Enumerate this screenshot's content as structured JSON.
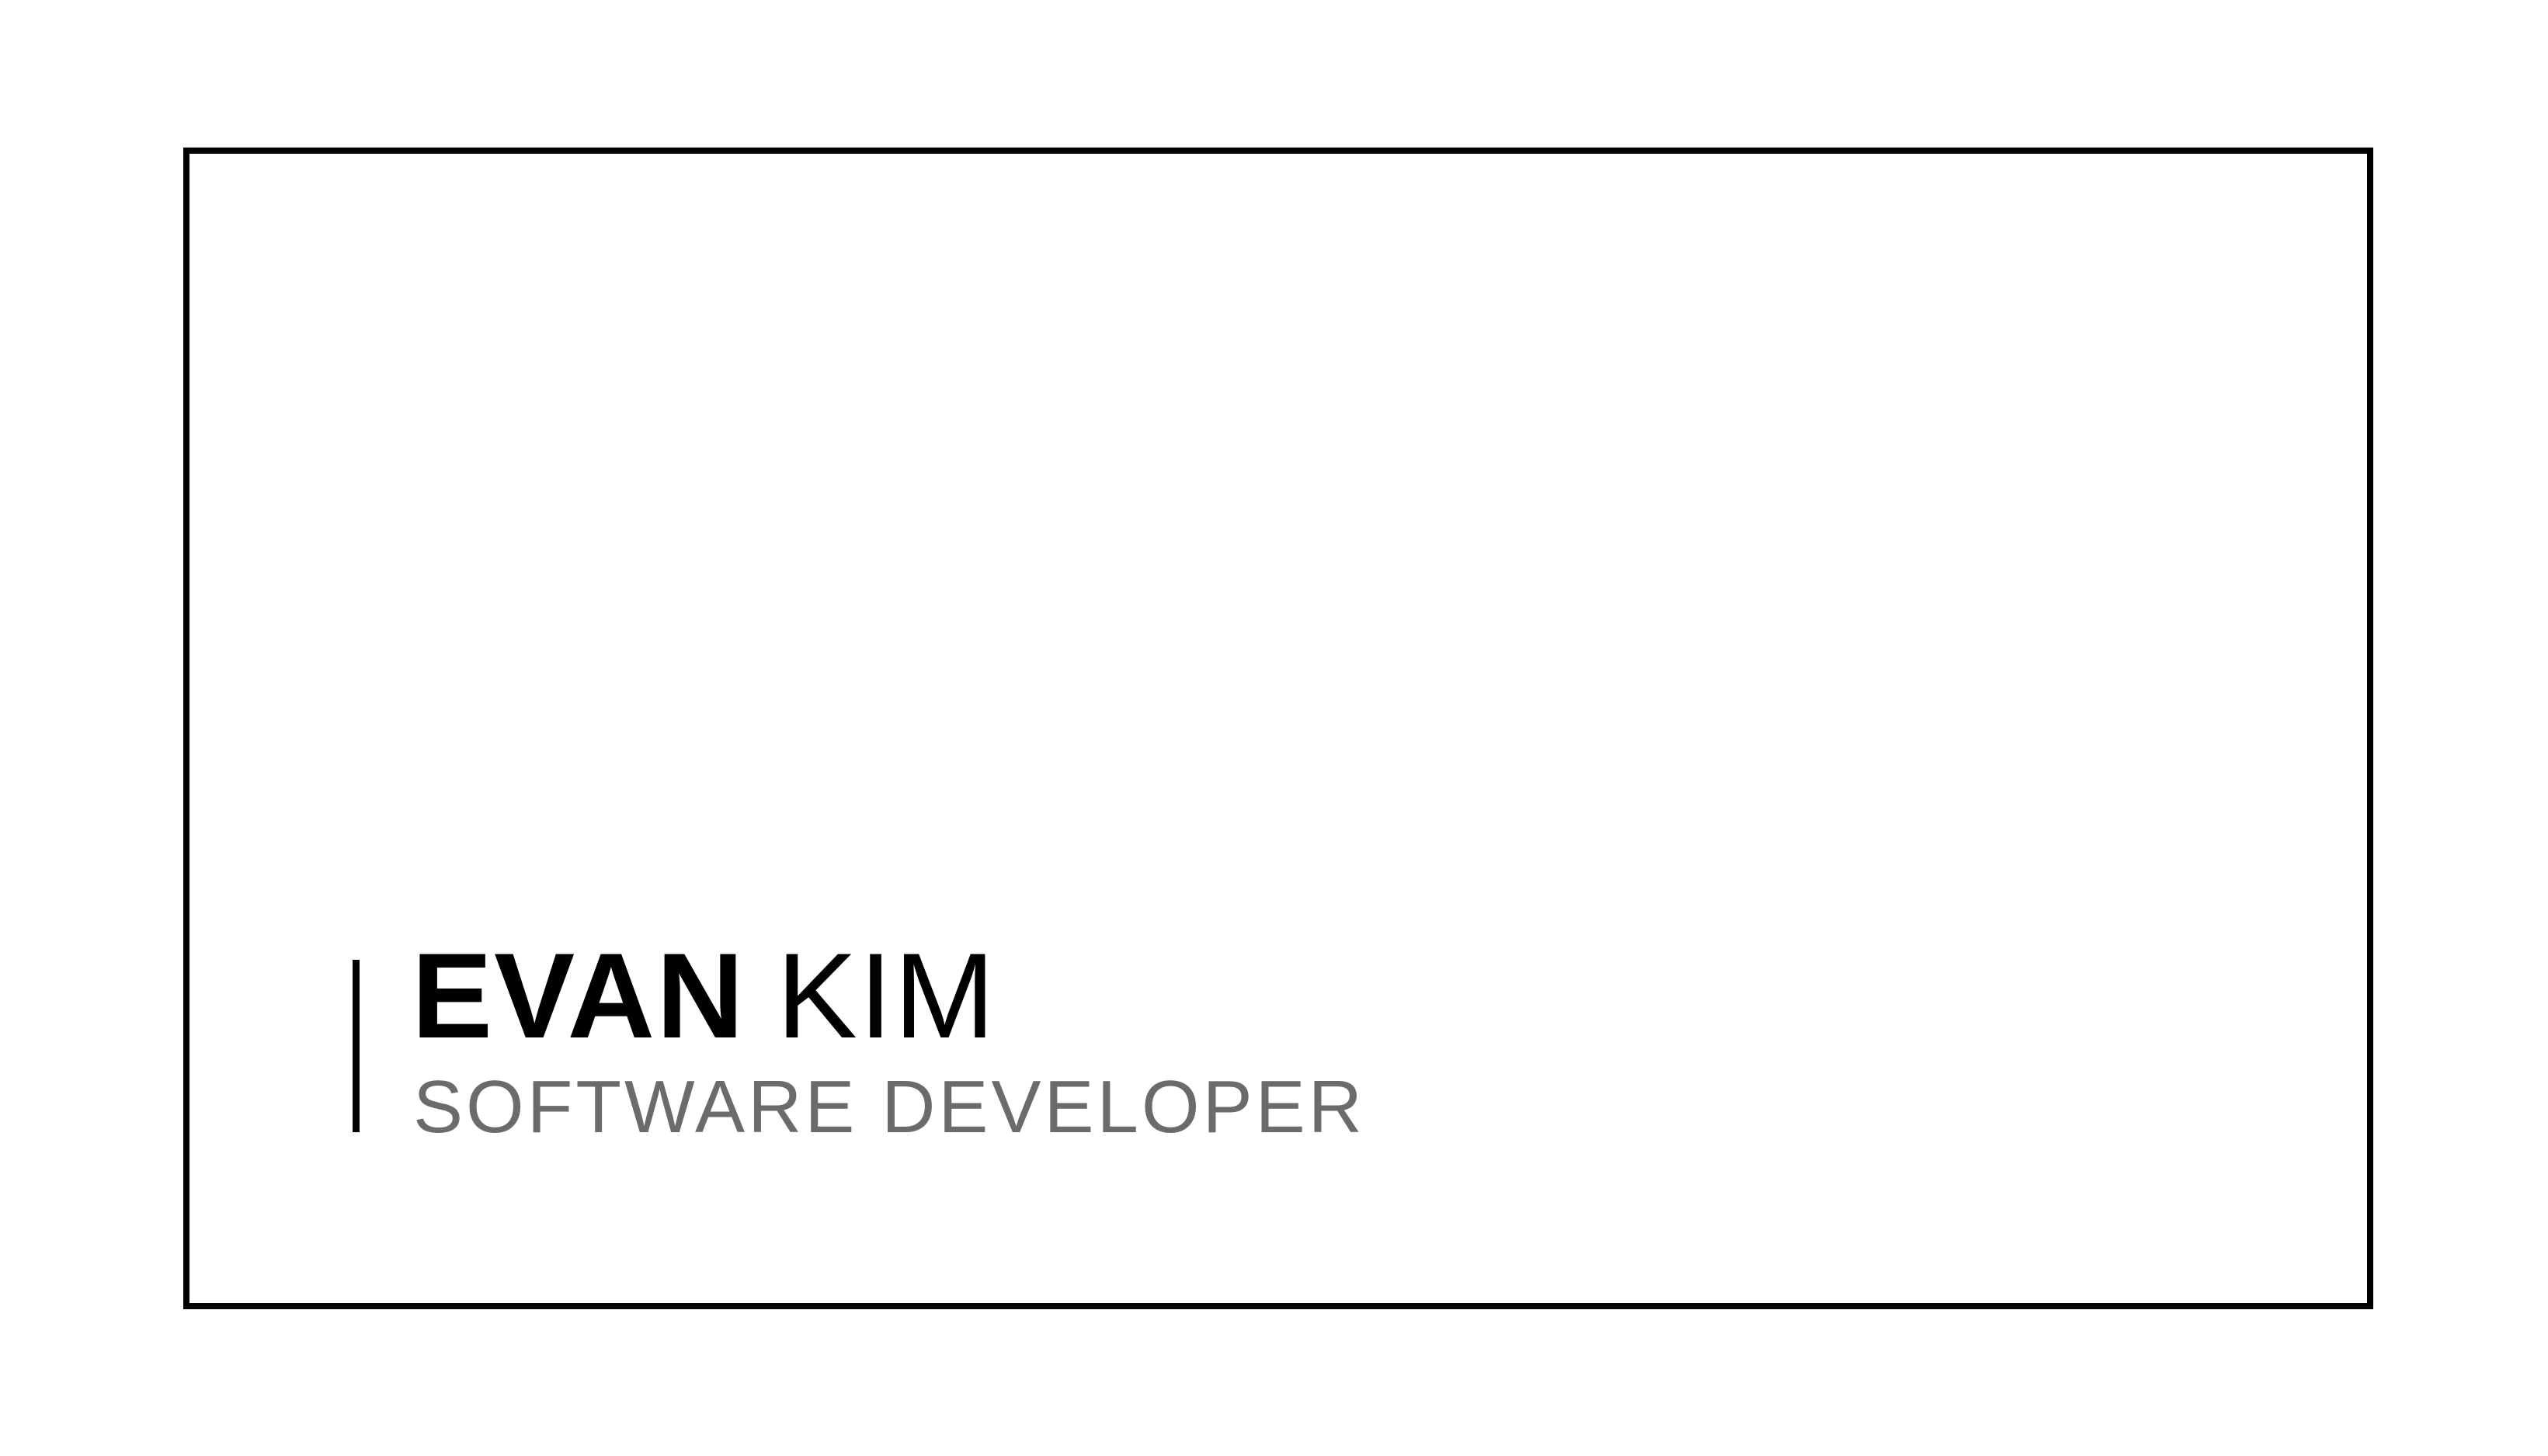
{
  "card": {
    "first_name": "EVAN",
    "last_name": "KIM",
    "title": "SOFTWARE DEVELOPER"
  },
  "colors": {
    "background": "#ffffff",
    "frame": "#000000",
    "name": "#000000",
    "title": "#6b6b6b"
  }
}
